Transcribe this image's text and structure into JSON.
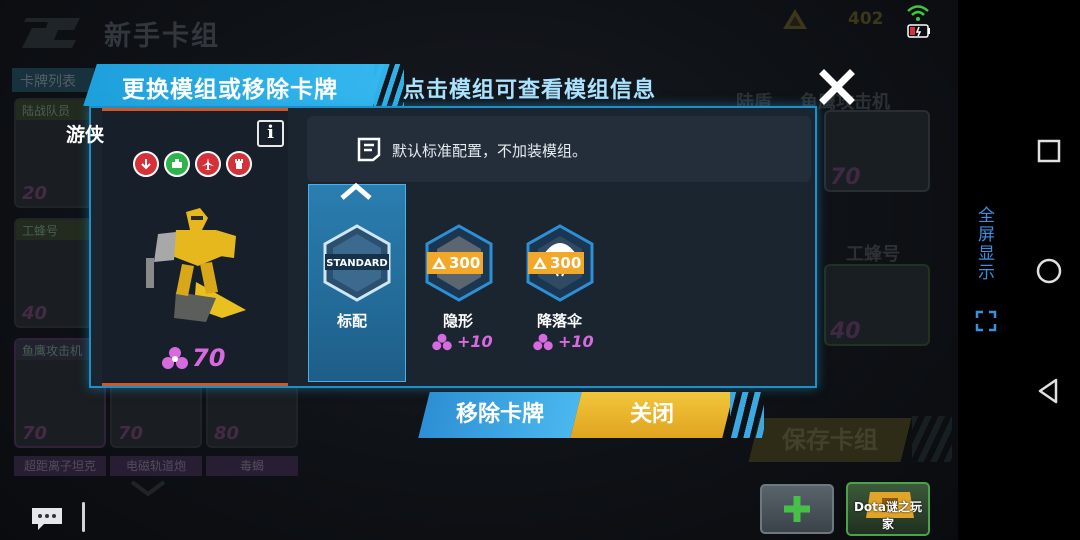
{
  "header": {
    "title": "新手卡组",
    "currency_value": "402"
  },
  "background": {
    "tab_label": "卡牌列表",
    "column_labels": [
      "陆战队员",
      "陆盾",
      "鱼鹰攻击机"
    ],
    "cards": [
      {
        "label": "陆战队员",
        "cost": "20"
      },
      {
        "label": "工蜂号",
        "cost": "40"
      },
      {
        "label": "鱼鹰攻击机",
        "cost": "70"
      },
      {
        "label": "",
        "cost": "70"
      },
      {
        "label": "",
        "cost": "80"
      }
    ],
    "bottom_labels": [
      "超距离子坦克",
      "电磁轨道炮",
      "毒蝎"
    ],
    "right_cards": [
      {
        "label": "鱼鹰攻击机",
        "cost": "70"
      },
      {
        "label": "工蜂号",
        "cost": "40"
      }
    ],
    "save_label": "保存卡组"
  },
  "modal": {
    "title": "更换模组或移除卡牌",
    "subtitle": "点击模组可查看模组信息",
    "unit": {
      "name": "游侠",
      "cost": "70",
      "traits": [
        "arrow-down-icon",
        "vehicle-icon",
        "aircraft-icon",
        "tower-icon"
      ]
    },
    "description": "默认标准配置，不加装模组。",
    "modules": [
      {
        "name": "标配",
        "badge": "STANDARD",
        "price": "",
        "bonus": ""
      },
      {
        "name": "隐形",
        "badge": "",
        "price": "300",
        "bonus": "+10"
      },
      {
        "name": "降落伞",
        "badge": "",
        "price": "300",
        "bonus": "+10"
      }
    ],
    "remove_label": "移除卡牌",
    "close_label": "关闭"
  },
  "bottom_bar": {
    "player_name": "Dota谜之玩家"
  },
  "system": {
    "fullscreen_label": "全屏显示"
  },
  "colors": {
    "accent_blue": "#1ea0dc",
    "close_yellow": "#f2c63a",
    "energy_purple": "#d86ae0",
    "price_orange": "#f2a92a"
  }
}
